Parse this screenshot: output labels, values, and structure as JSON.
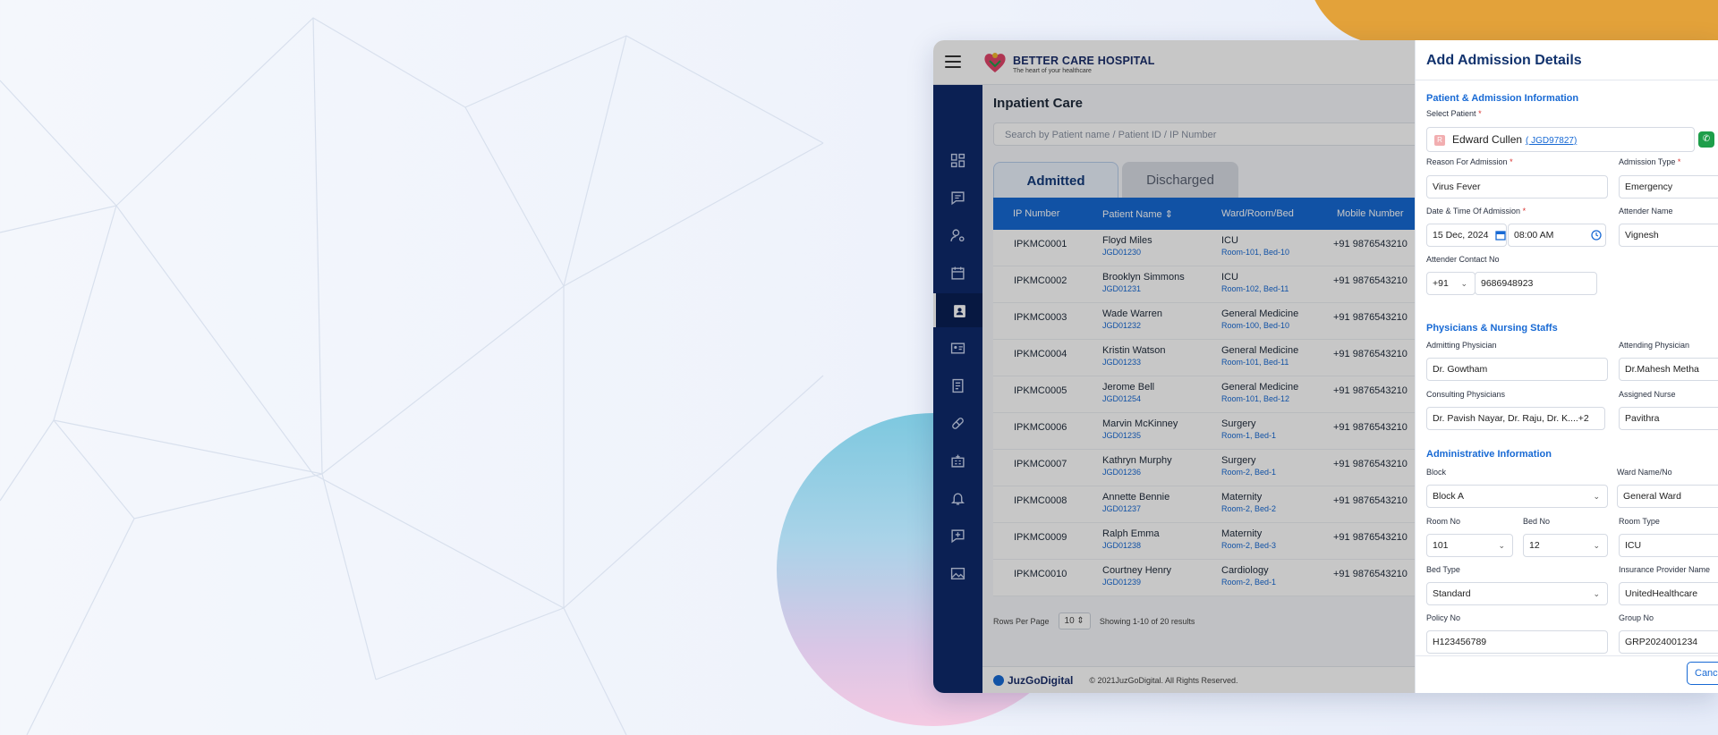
{
  "app": {
    "brand": "BETTER CARE HOSPITAL",
    "tagline": "The heart of your healthcare"
  },
  "sidebar": {
    "items": [
      {
        "icon": "dashboard-icon"
      },
      {
        "icon": "chat-icon"
      },
      {
        "icon": "user-settings-icon"
      },
      {
        "icon": "calendar-icon"
      },
      {
        "icon": "inpatient-icon",
        "active": true
      },
      {
        "icon": "id-card-icon"
      },
      {
        "icon": "report-icon"
      },
      {
        "icon": "pill-icon"
      },
      {
        "icon": "hospital-icon"
      },
      {
        "icon": "alarm-icon"
      },
      {
        "icon": "add-message-icon"
      },
      {
        "icon": "gallery-icon"
      }
    ]
  },
  "main": {
    "title": "Inpatient Care",
    "search_placeholder": "Search by Patient name / Patient ID / IP Number",
    "tabs": [
      {
        "label": "Admitted",
        "active": true
      },
      {
        "label": "Discharged",
        "active": false
      }
    ],
    "columns": [
      "IP Number",
      "Patient Name",
      "Ward/Room/Bed",
      "Mobile Number"
    ],
    "rows": [
      {
        "ip": "IPKMC0001",
        "name": "Floyd Miles",
        "pid": "JGD01230",
        "ward": "ICU",
        "room": "Room-101,  Bed-10",
        "mobile": "+91 9876543210"
      },
      {
        "ip": "IPKMC0002",
        "name": "Brooklyn Simmons",
        "pid": "JGD01231",
        "ward": "ICU",
        "room": "Room-102,  Bed-11",
        "mobile": "+91 9876543210"
      },
      {
        "ip": "IPKMC0003",
        "name": "Wade Warren",
        "pid": "JGD01232",
        "ward": "General Medicine",
        "room": "Room-100,  Bed-10",
        "mobile": "+91 9876543210"
      },
      {
        "ip": "IPKMC0004",
        "name": "Kristin Watson",
        "pid": "JGD01233",
        "ward": "General Medicine",
        "room": "Room-101,  Bed-11",
        "mobile": "+91 9876543210"
      },
      {
        "ip": "IPKMC0005",
        "name": "Jerome Bell",
        "pid": "JGD01254",
        "ward": "General Medicine",
        "room": "Room-101,  Bed-12",
        "mobile": "+91 9876543210"
      },
      {
        "ip": "IPKMC0006",
        "name": "Marvin McKinney",
        "pid": "JGD01235",
        "ward": "Surgery",
        "room": "Room-1,  Bed-1",
        "mobile": "+91 9876543210"
      },
      {
        "ip": "IPKMC0007",
        "name": "Kathryn Murphy",
        "pid": "JGD01236",
        "ward": "Surgery",
        "room": "Room-2,  Bed-1",
        "mobile": "+91 9876543210"
      },
      {
        "ip": "IPKMC0008",
        "name": "Annette Bennie",
        "pid": "JGD01237",
        "ward": "Maternity",
        "room": "Room-2,  Bed-2",
        "mobile": "+91 9876543210"
      },
      {
        "ip": "IPKMC0009",
        "name": "Ralph Emma",
        "pid": "JGD01238",
        "ward": "Maternity",
        "room": "Room-2,  Bed-3",
        "mobile": "+91 9876543210"
      },
      {
        "ip": "IPKMC0010",
        "name": "Courtney Henry",
        "pid": "JGD01239",
        "ward": "Cardiology",
        "room": "Room-2,  Bed-1",
        "mobile": "+91 9876543210"
      }
    ],
    "rows_per_page_label": "Rows Per Page",
    "rows_per_page": "10",
    "showing": "Showing 1-10 of 20 results"
  },
  "footer": {
    "brand": "JuzGoDigital",
    "copyright": "© 2021JuzGoDigital. All Rights Reserved."
  },
  "drawer": {
    "title": "Add Admission Details",
    "sections": {
      "patient": "Patient & Admission Information",
      "physicians": "Physicians & Nursing Staffs",
      "admin": "Administrative Information"
    },
    "fields": {
      "select_patient_label": "Select Patient",
      "patient_badge": "R",
      "patient_name": "Edward Cullen",
      "patient_id": "( JGD97827)",
      "reason_label": "Reason For Admission",
      "reason": "Virus Fever",
      "admission_type_label": "Admission Type",
      "admission_type": "Emergency",
      "datetime_label": "Date & Time Of Admission",
      "date": "15 Dec, 2024",
      "time": "08:00 AM",
      "attender_name_label": "Attender Name",
      "attender_name": "Vignesh",
      "attender_contact_label": "Attender Contact No",
      "country_code": "+91",
      "attender_contact": "9686948923",
      "admitting_label": "Admitting Physician",
      "admitting": "Dr. Gowtham",
      "attending_label": "Attending Physician",
      "attending": "Dr.Mahesh Metha",
      "consulting_label": "Consulting Physicians",
      "consulting": "Dr. Pavish Nayar, Dr. Raju, Dr. K....+2",
      "nurse_label": "Assigned Nurse",
      "nurse": "Pavithra",
      "block_label": "Block",
      "block": "Block A",
      "ward_label": "Ward Name/No",
      "ward": "General Ward",
      "room_no_label": "Room No",
      "room_no": "101",
      "bed_no_label": "Bed No",
      "bed_no": "12",
      "room_type_label": "Room Type",
      "room_type": "ICU",
      "bed_type_label": "Bed Type",
      "bed_type": "Standard",
      "insurance_label": "Insurance Provider Name",
      "insurance": "UnitedHealthcare",
      "policy_label": "Policy No",
      "policy": "H123456789",
      "group_label": "Group No",
      "group": "GRP2024001234",
      "required_mark": "*"
    },
    "cancel_label": "Canc"
  },
  "colors": {
    "sidebar": "#0f2a6b",
    "primary": "#1769d4",
    "accent_orange": "#e3a23a",
    "required": "#d8312f"
  }
}
